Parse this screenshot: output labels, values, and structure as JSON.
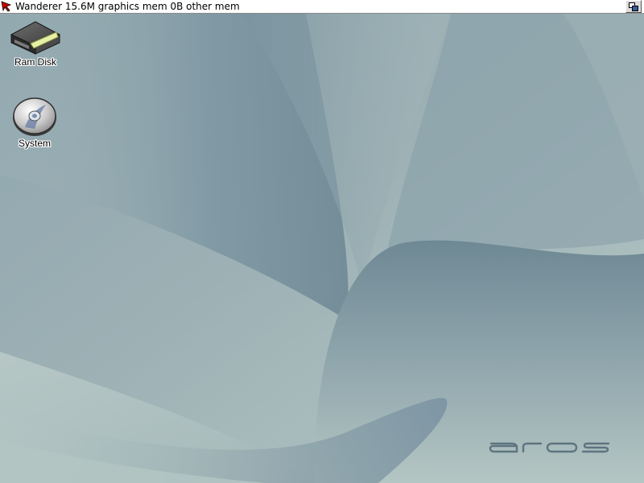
{
  "screen": {
    "title": "Wanderer 15.6M graphics mem 0B other mem"
  },
  "desktop": {
    "icons": [
      {
        "label": "Ram Disk",
        "icon": "ram-disk-icon"
      },
      {
        "label": "System",
        "icon": "system-disk-icon"
      }
    ],
    "logo_text": "aros"
  },
  "colors": {
    "background_light": "#b4c6c4",
    "background_dark": "#6d8793",
    "titlebar": "#ffffff",
    "logo": "#5e7480"
  }
}
